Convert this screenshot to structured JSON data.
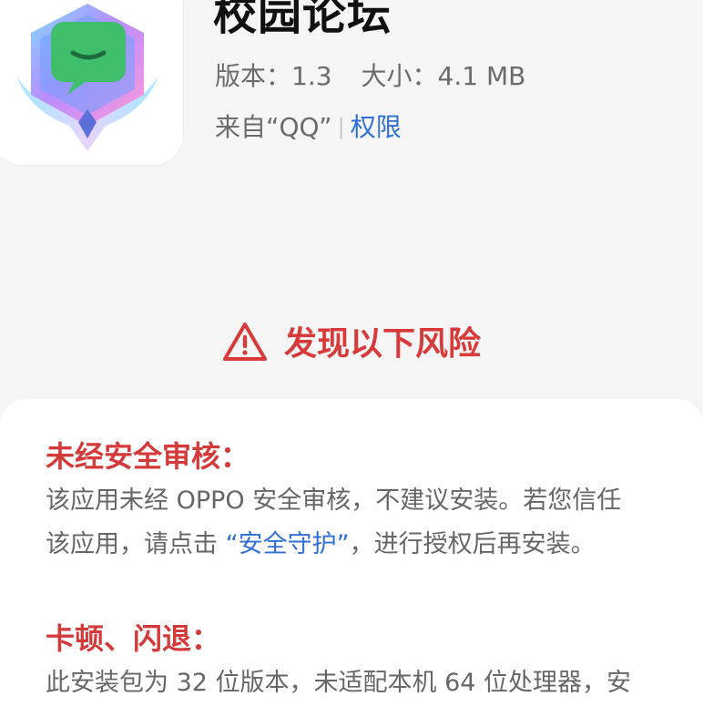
{
  "app": {
    "name": "校园论坛",
    "version": "版本：1.3",
    "size": "大小：4.1 MB",
    "source": "来自“QQ”",
    "permissions_link": "权限"
  },
  "risk": {
    "heading": "发现以下风险",
    "items": [
      {
        "title": "未经安全审核：",
        "desc_line1": "该应用未经 OPPO 安全审核，不建议安装。若您信任",
        "desc_line2_a": "该应用，请点击 ",
        "desc_line2_link": "“安全守护”",
        "desc_line2_b": "，进行授权后再安装。"
      },
      {
        "title": "卡顿、闪退：",
        "desc_line1": "此安装包为 32 位版本，未适配本机 64 位处理器，安"
      }
    ]
  },
  "colors": {
    "danger": "#d83a3a",
    "link": "#2f6fd6",
    "background": "#f5f5f5",
    "sheet": "#ffffff"
  },
  "icons": {
    "app_icon": "chat-shield-icon",
    "warning": "warning-triangle-icon"
  }
}
